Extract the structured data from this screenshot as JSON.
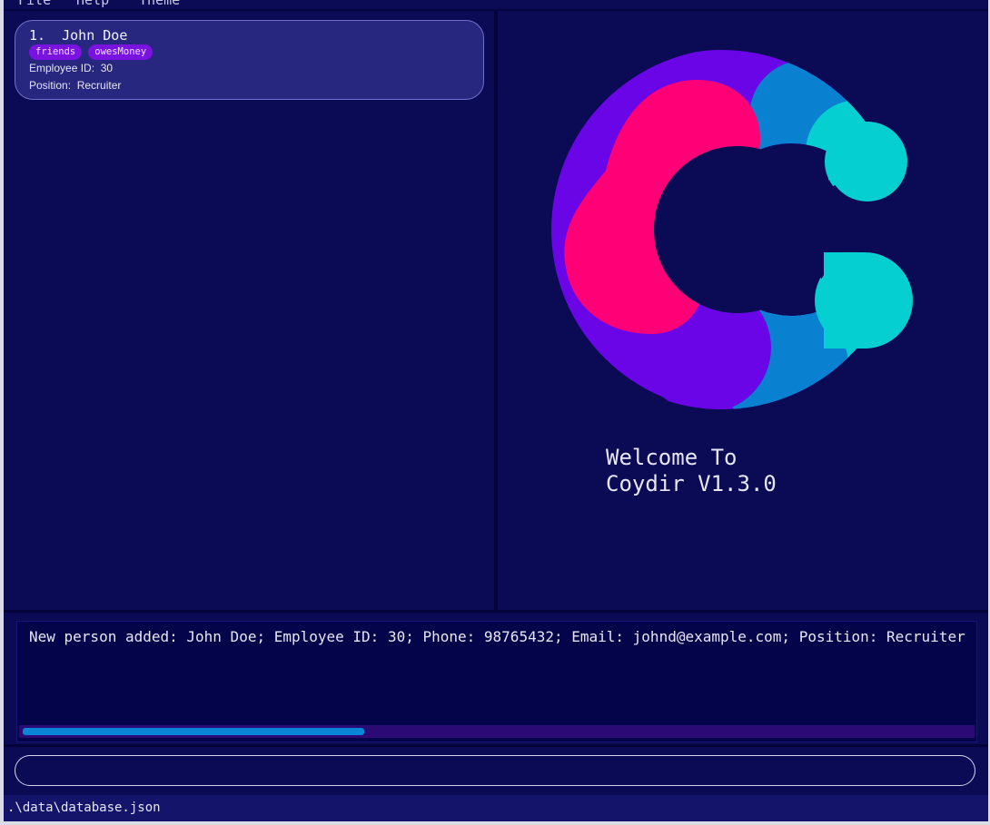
{
  "menubar": {
    "items": [
      "File",
      "Help",
      "Theme"
    ]
  },
  "person_list": [
    {
      "title": "1.  John Doe",
      "tags": [
        "friends",
        "owesMoney"
      ],
      "employee_id": "Employee ID:  30",
      "position": "Position:  Recruiter"
    }
  ],
  "welcome": {
    "line1": "Welcome To",
    "line2": "Coydir V1.3.0"
  },
  "logo": {
    "colors": [
      "#ff0077",
      "#6a05e8",
      "#0a80d0",
      "#05cfd0"
    ]
  },
  "result": {
    "text": "New person added: John Doe; Employee ID: 30; Phone: 98765432; Email: johnd@example.com; Position: Recruiter",
    "progress": 0.36
  },
  "command": {
    "value": "",
    "placeholder": ""
  },
  "status": {
    "file_path": ".\\data\\database.json"
  },
  "colors": {
    "background": "#0b0b55",
    "card": "#27277f",
    "tag": "#7a12e0",
    "progress": "#0a86d6"
  }
}
